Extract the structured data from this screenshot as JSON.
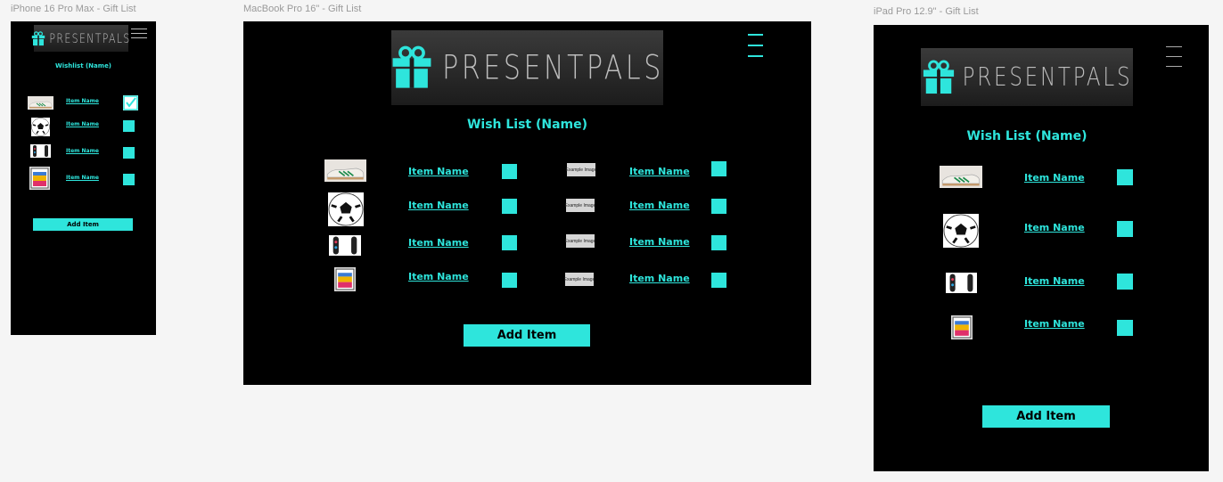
{
  "frames": {
    "phone": {
      "label": "iPhone 16 Pro Max - Gift List"
    },
    "laptop": {
      "label": "MacBook Pro 16\" - Gift List"
    },
    "tablet": {
      "label": "iPad Pro 12.9\" - Gift List"
    }
  },
  "logo": {
    "text": "PRESENTPALS"
  },
  "phone": {
    "title": "Wishlist (Name)"
  },
  "main": {
    "title": "Wish List (Name)"
  },
  "items": [
    {
      "name": "Item Name",
      "image": "sneaker-photo"
    },
    {
      "name": "Item Name",
      "image": "soccer-ball-photo"
    },
    {
      "name": "Item Name",
      "image": "skateboard-photo"
    },
    {
      "name": "Item Name",
      "image": "tablet-device-photo"
    }
  ],
  "laptop_extra_items": [
    {
      "name": "Item Name",
      "image_label": "Example Image"
    },
    {
      "name": "Item Name",
      "image_label": "Example Image"
    },
    {
      "name": "Item Name",
      "image_label": "Example Image"
    },
    {
      "name": "Item Name",
      "image_label": "Example Image"
    }
  ],
  "phone_checked_first": true,
  "add_item_label": "Add Item",
  "icons": {
    "menu": "hamburger-menu-icon",
    "logo": "gift-box-icon",
    "check": "checkmark-icon"
  },
  "colors": {
    "accent": "#2ee5dc",
    "background": "#000000",
    "canvas": "#f5f5f5"
  }
}
